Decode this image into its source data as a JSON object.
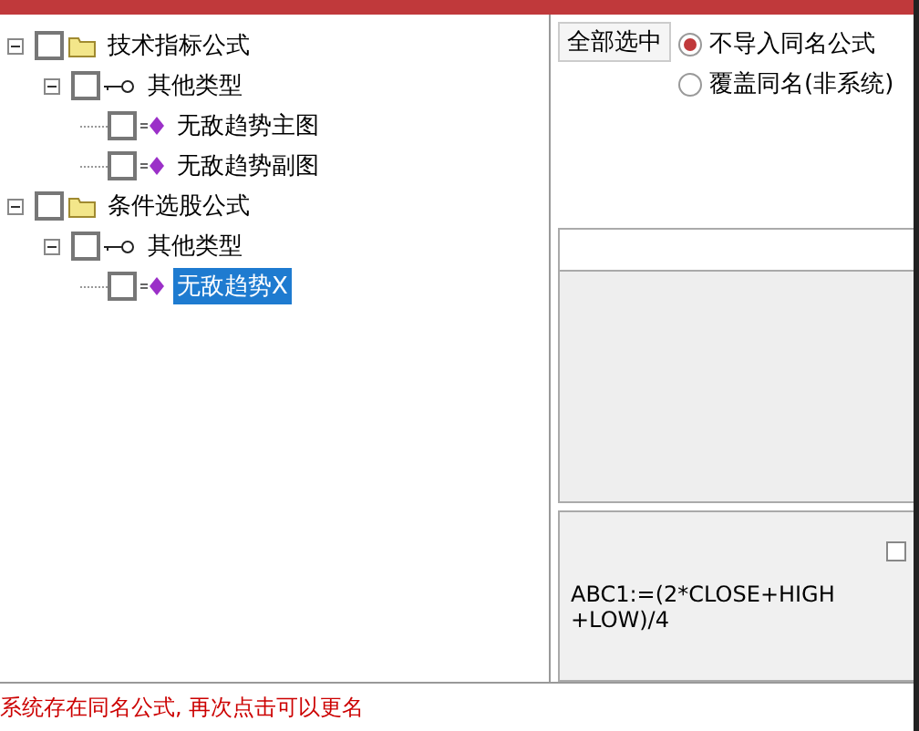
{
  "tree": [
    {
      "label": "技术指标公式",
      "kind": "folder",
      "checked": false,
      "expanded": true,
      "selected": false,
      "children": [
        {
          "label": "其他类型",
          "kind": "category",
          "checked": false,
          "expanded": true,
          "selected": false,
          "children": [
            {
              "label": "无敌趋势主图",
              "kind": "formula",
              "checked": false,
              "selected": false
            },
            {
              "label": "无敌趋势副图",
              "kind": "formula",
              "checked": false,
              "selected": false
            }
          ]
        }
      ]
    },
    {
      "label": "条件选股公式",
      "kind": "folder",
      "checked": false,
      "expanded": true,
      "selected": false,
      "children": [
        {
          "label": "其他类型",
          "kind": "category",
          "checked": false,
          "expanded": true,
          "selected": false,
          "children": [
            {
              "label": "无敌趋势X",
              "kind": "formula",
              "checked": false,
              "selected": true
            }
          ]
        }
      ]
    }
  ],
  "select_all_button": "全部选中",
  "options": [
    {
      "label": "不导入同名公式",
      "selected": true
    },
    {
      "label": "覆盖同名(非系统)",
      "selected": false
    }
  ],
  "preview": {
    "checked": false,
    "lines": [
      "ABC1:=(2*CLOSE+HIGH",
      "+LOW)/4"
    ]
  },
  "status": "系统存在同名公式, 再次点击可以更名"
}
